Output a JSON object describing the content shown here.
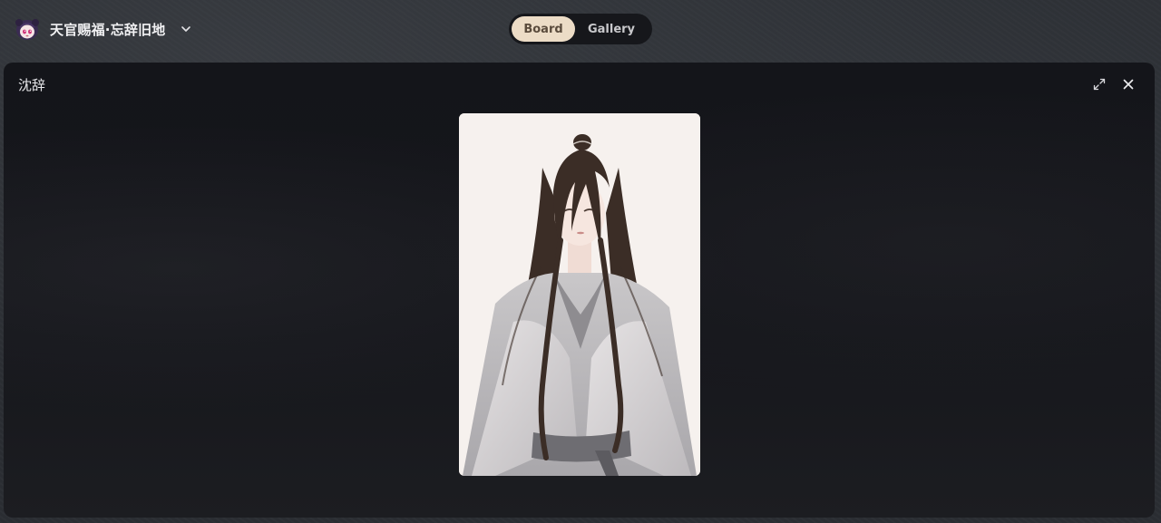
{
  "app": {
    "workspace_name": "天官赐福·忘辞旧地",
    "avatar_icon": "chibi-character-avatar",
    "switcher_icon": "chevron-down-icon"
  },
  "view_toggle": {
    "options": [
      {
        "label": "Board",
        "active": true
      },
      {
        "label": "Gallery",
        "active": false
      }
    ]
  },
  "modal": {
    "title": "沈辞",
    "expand_icon": "expand-icon",
    "close_icon": "close-icon",
    "image_subject": "long-haired-man-in-grey-robes-portrait"
  },
  "background_page": {
    "character_name": "沈辞"
  },
  "colors": {
    "active_segment_bg": "#ecdcc6",
    "active_segment_text": "#5a4b3c",
    "modal_bg": "#15161b",
    "segment_track": "#16171b"
  }
}
